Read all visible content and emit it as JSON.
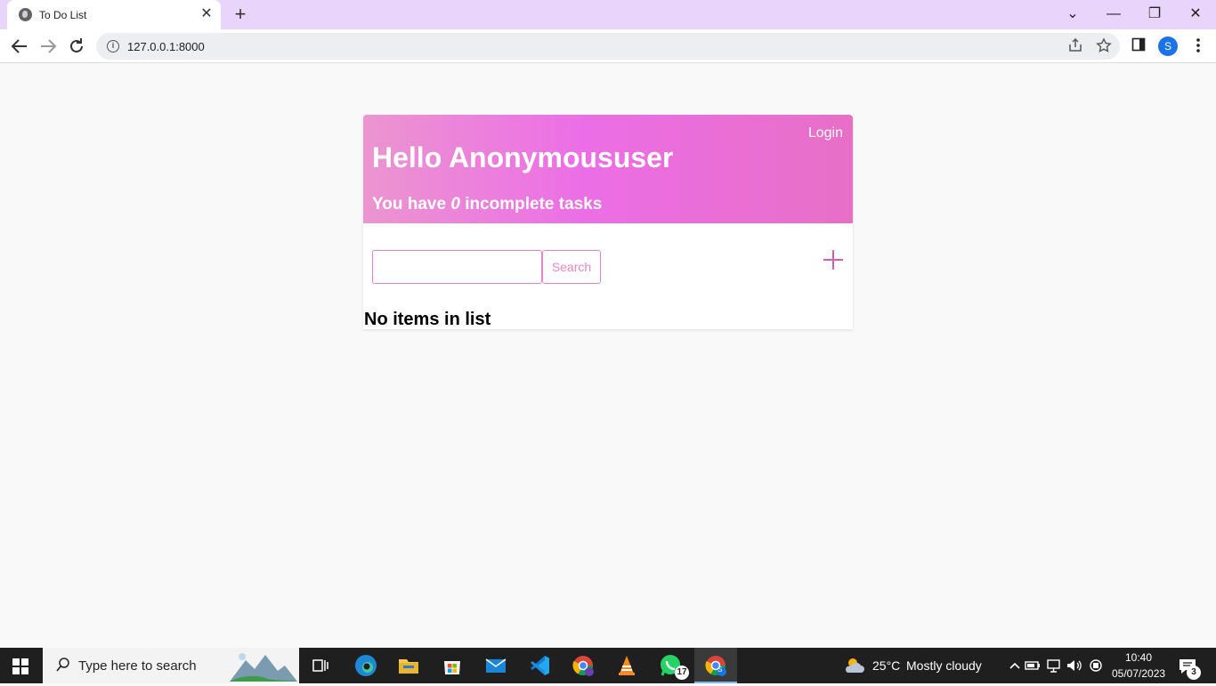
{
  "browser": {
    "tab_title": "To Do List",
    "tab_close": "✕",
    "new_tab": "+",
    "url": "127.0.0.1:8000",
    "profile_initial": "S",
    "window_controls": {
      "menu": "⌄",
      "minimize": "—",
      "restore": "❐",
      "close": "✕"
    }
  },
  "app": {
    "login_label": "Login",
    "greeting": "Hello Anonymoususer",
    "tasks_prefix": "You have ",
    "tasks_count": "0",
    "tasks_suffix": " incomplete tasks",
    "search_placeholder": "",
    "search_value": "",
    "search_button": "Search",
    "empty_message": "No items in list",
    "accent_color": "#ea83c8",
    "header_gradient": [
      "#ec95d0",
      "#ec6ee6",
      "#e86fc6"
    ]
  },
  "taskbar": {
    "search_text": "Type here to search",
    "weather_temp": "25°C",
    "weather_desc": "Mostly cloudy",
    "time": "10:40",
    "date": "05/07/2023",
    "whatsapp_badge": "17",
    "notification_badge": "3",
    "chrome_profile_letter": "S"
  }
}
